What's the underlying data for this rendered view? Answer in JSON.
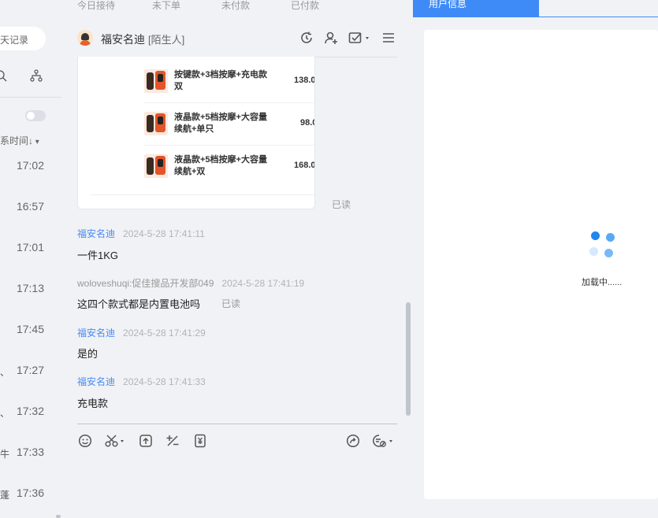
{
  "top_tabs": [
    "今日接待",
    "未下单",
    "未付款",
    "已付款"
  ],
  "left": {
    "search_text": "天记录",
    "sort_label": "系时间↓",
    "contacts": [
      {
        "time": "17:02",
        "frag": ""
      },
      {
        "time": "16:57",
        "frag": ""
      },
      {
        "time": "17:01",
        "frag": ""
      },
      {
        "time": "17:13",
        "frag": ""
      },
      {
        "time": "17:45",
        "frag": ""
      },
      {
        "time": "17:27",
        "frag": "、"
      },
      {
        "time": "17:32",
        "frag": "、"
      },
      {
        "time": "17:33",
        "frag": "牛"
      },
      {
        "time": "17:36",
        "frag": "蓬"
      }
    ]
  },
  "chat": {
    "name": "福安名迪",
    "tag": "[陌生人]",
    "products": [
      {
        "title": "按键款+3档按摩+充电款双",
        "price": "138.0"
      },
      {
        "title": "液晶款+5档按摩+大容量续航+单只",
        "price": "98.0"
      },
      {
        "title": "液晶款+5档按摩+大容量续航+双",
        "price": "168.0"
      }
    ],
    "card_read": "已读",
    "messages": [
      {
        "sender": "福安名迪",
        "time": "2024-5-28 17:41:11",
        "text": "一件1KG",
        "read": ""
      },
      {
        "sender": "woloveshuqi:促佳搜品开发部049",
        "time": "2024-5-28 17:41:19",
        "text": "这四个款式都是内置电池吗",
        "read": "已读"
      },
      {
        "sender": "福安名迪",
        "time": "2024-5-28 17:41:29",
        "text": "是的",
        "read": ""
      },
      {
        "sender": "福安名迪",
        "time": "2024-5-28 17:41:33",
        "text": "充电款",
        "read": ""
      }
    ]
  },
  "right": {
    "tab_label": "用户信息",
    "loading_text": "加载中......"
  },
  "colors": {
    "accent": "#3e8bf7",
    "sender_link": "#4a8af4",
    "background": "#f0f2f5"
  },
  "icons": {
    "header": [
      "history-icon",
      "user-add-icon",
      "order-check-icon",
      "menu-icon"
    ],
    "toolbar": [
      "emoji-icon",
      "scissors-icon",
      "upload-icon",
      "plus-minus-icon",
      "coupon-icon",
      "share-icon",
      "quick-reply-icon"
    ]
  }
}
